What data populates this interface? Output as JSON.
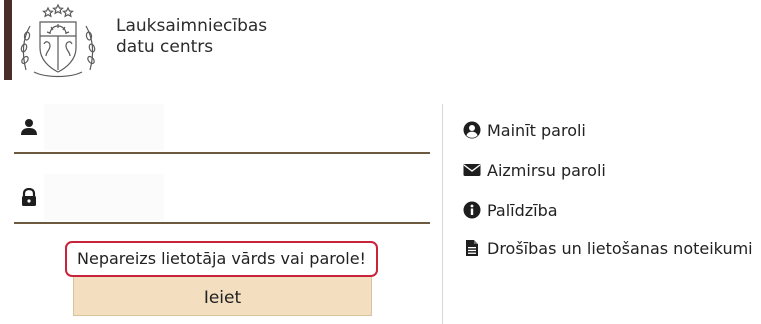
{
  "brand": {
    "line1": "Lauksaimniecības",
    "line2": "datu centrs",
    "bar_color": "#4a2e2a"
  },
  "login": {
    "username_icon": "user-icon",
    "username_value": "",
    "password_icon": "lock-icon",
    "password_value": "",
    "error_message": "Nepareizs lietotāja vārds vai parole!",
    "error_color": "#c8233a",
    "submit_label": "Ieiet",
    "submit_color": "#f3dfc0"
  },
  "links": [
    {
      "icon": "user-circle-icon",
      "label": "Mainīt paroli"
    },
    {
      "icon": "envelope-icon",
      "label": "Aizmirsu paroli"
    },
    {
      "icon": "info-circle-icon",
      "label": "Palīdzība"
    },
    {
      "icon": "document-icon",
      "label": "Drošības un lietošanas noteikumi"
    }
  ]
}
